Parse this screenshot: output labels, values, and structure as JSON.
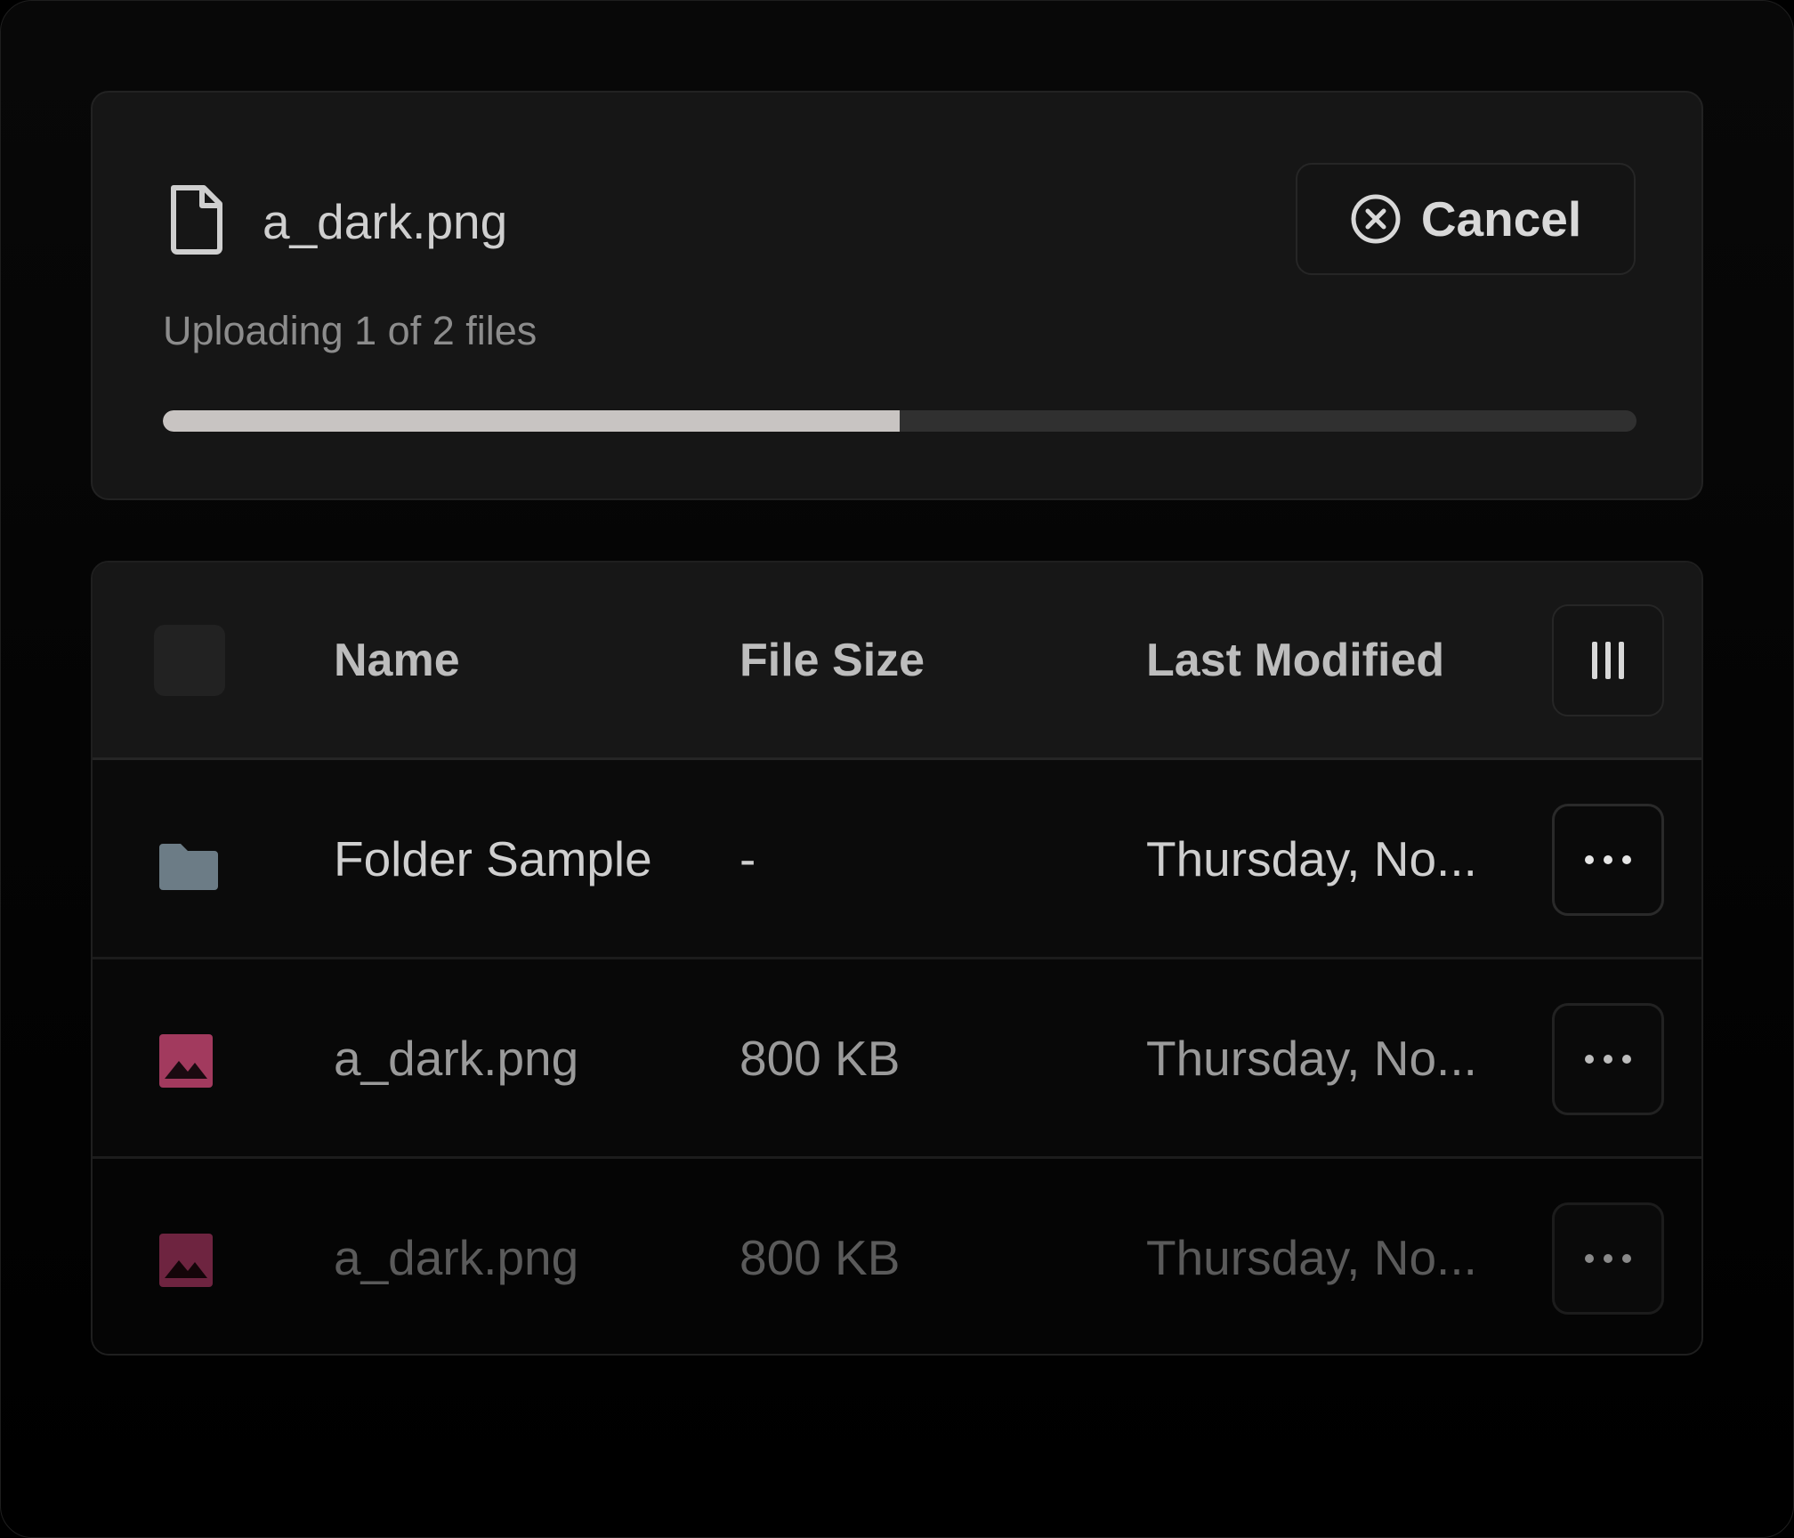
{
  "upload": {
    "file_name": "a_dark.png",
    "cancel_label": "Cancel",
    "status": "Uploading 1 of 2 files",
    "progress_percent": 50
  },
  "table": {
    "headers": {
      "name": "Name",
      "size": "File Size",
      "modified": "Last Modified"
    },
    "rows": [
      {
        "type": "folder",
        "name": "Folder Sample",
        "size": "-",
        "modified": "Thursday, No..."
      },
      {
        "type": "image",
        "name": "a_dark.png",
        "size": "800 KB",
        "modified": "Thursday, No..."
      },
      {
        "type": "image",
        "name": "a_dark.png",
        "size": "800 KB",
        "modified": "Thursday, No..."
      }
    ]
  },
  "colors": {
    "folder_icon": "#6c7c86",
    "image_icon": "#a23a5e",
    "image_icon_dim": "#6e2440",
    "progress_fill": "#c8c4c2"
  },
  "icons": {
    "file": "file-icon",
    "cancel": "x-circle-icon",
    "columns": "columns-icon",
    "folder": "folder-icon",
    "image": "image-icon",
    "more": "more-horizontal-icon"
  }
}
